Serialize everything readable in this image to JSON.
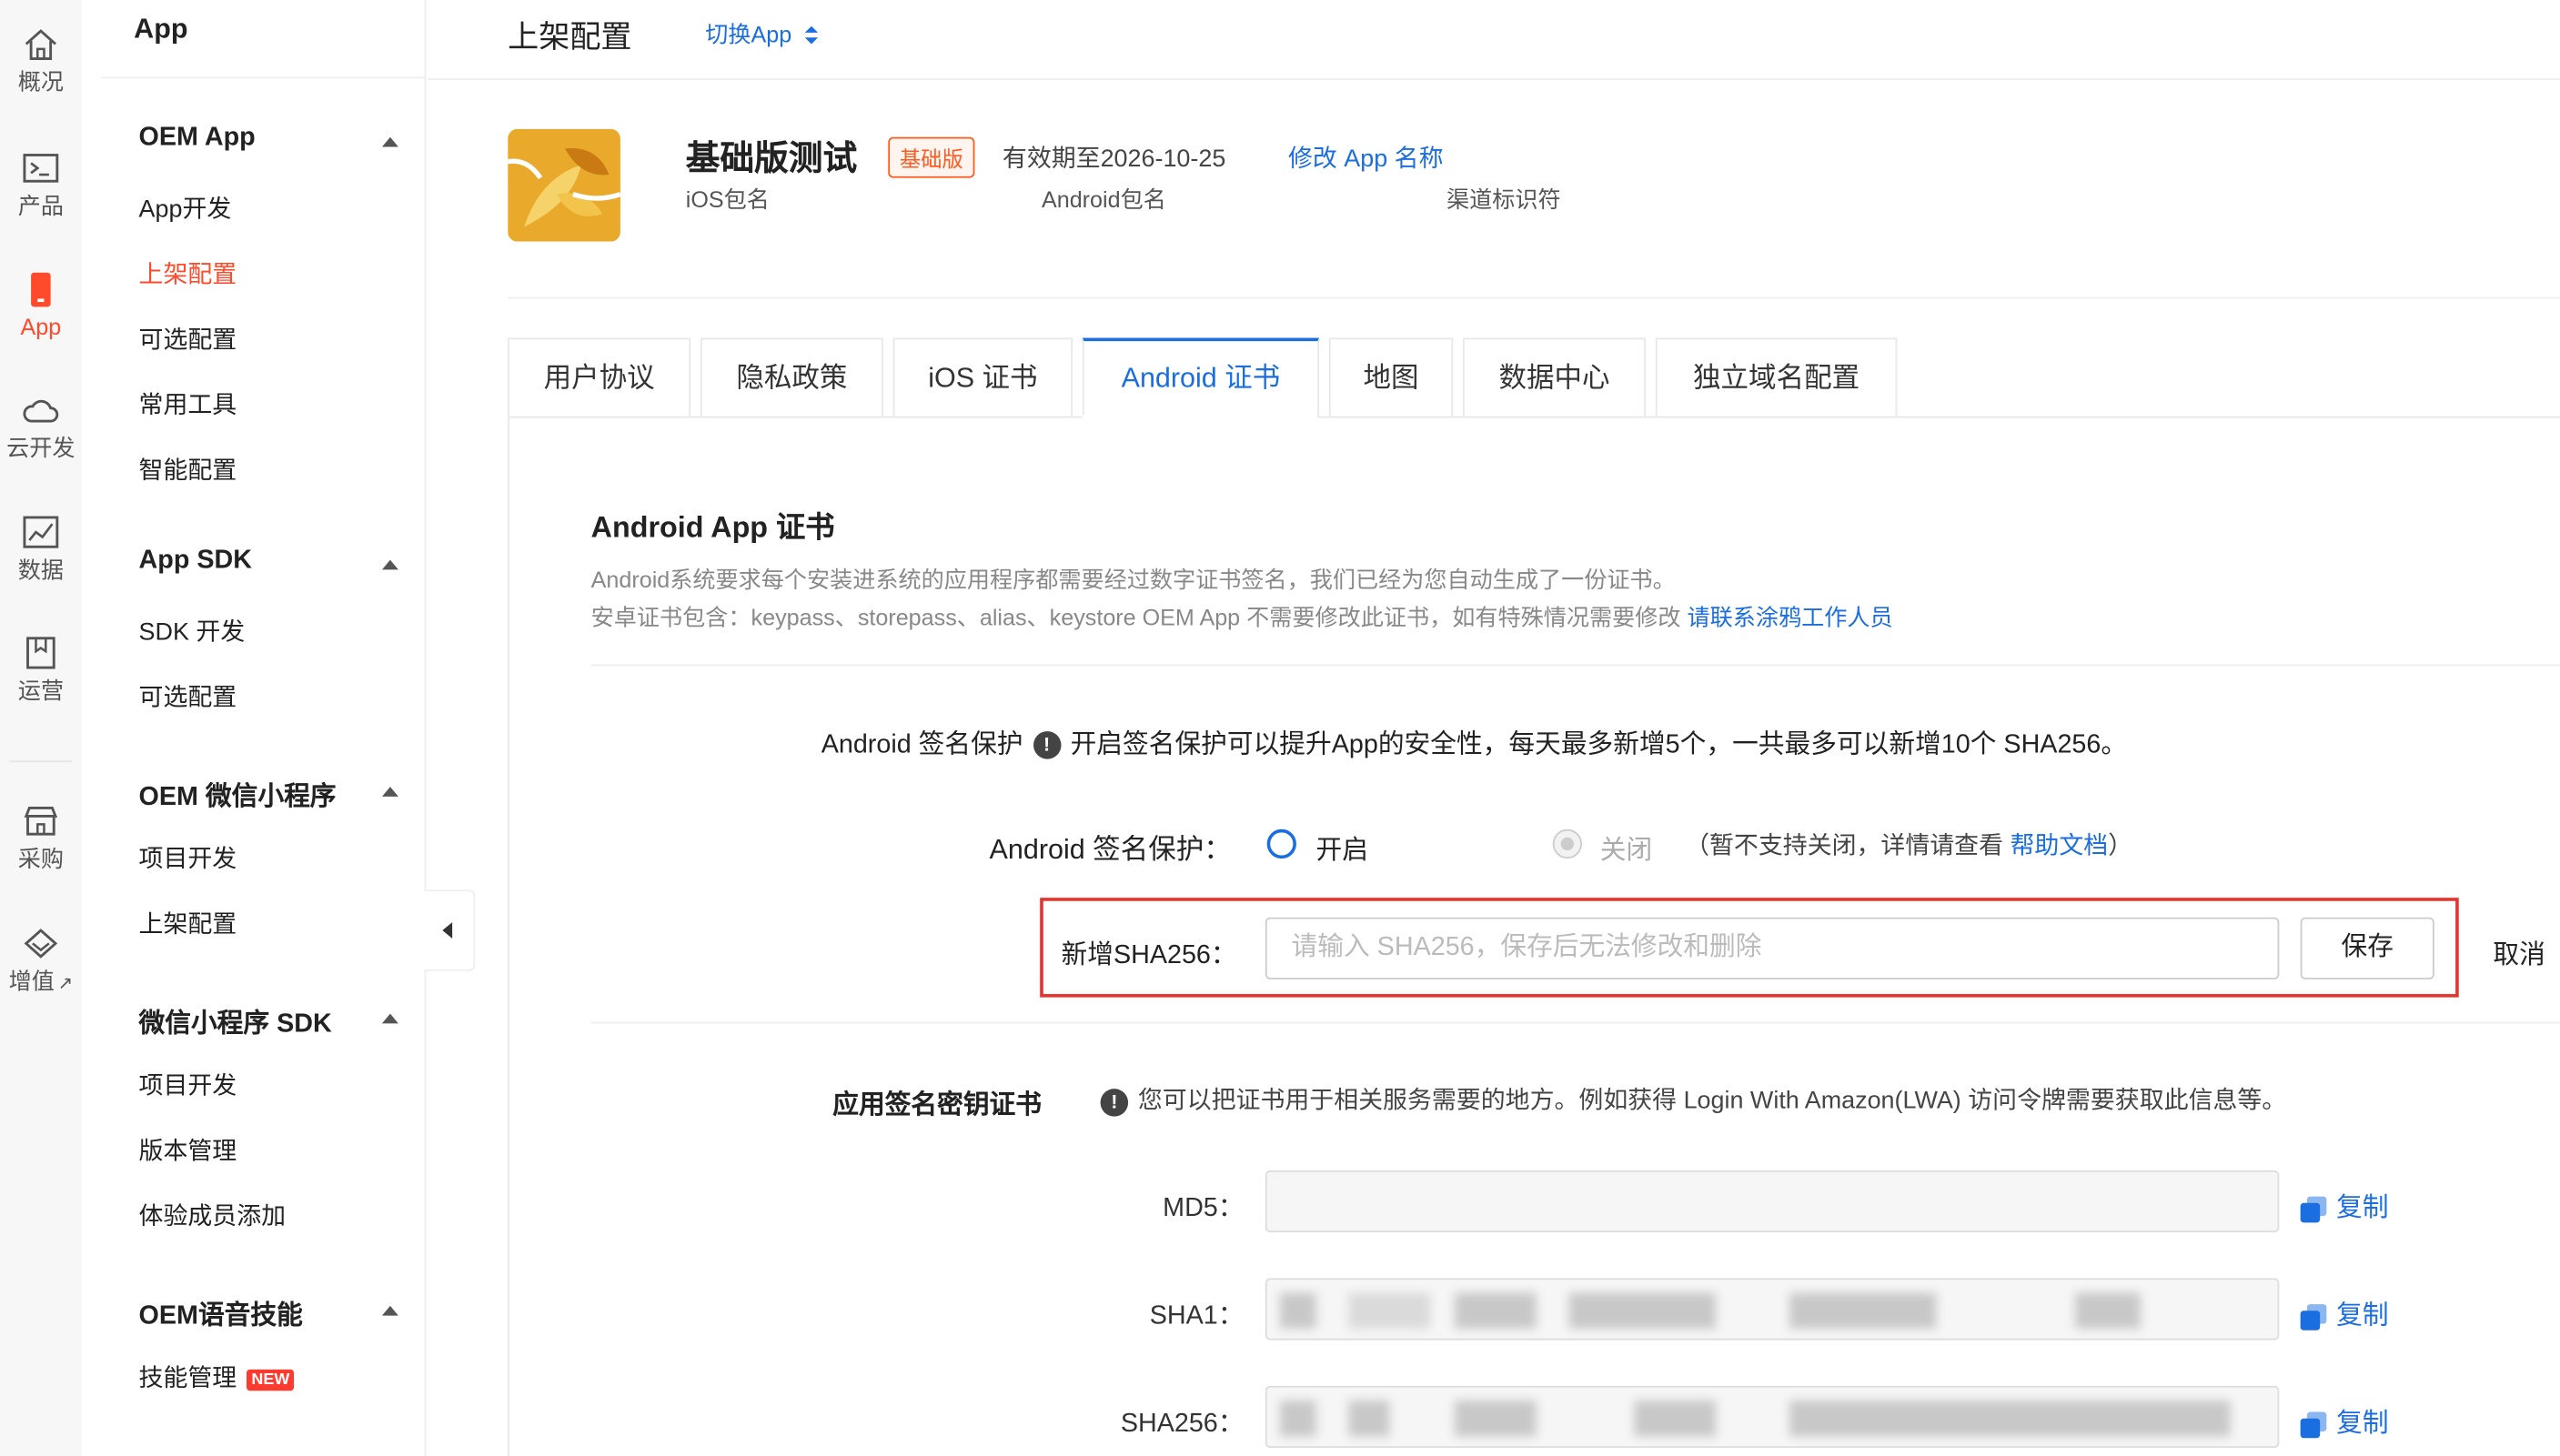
{
  "rail": {
    "items": [
      {
        "label": "概况",
        "icon": "home-icon"
      },
      {
        "label": "产品",
        "icon": "terminal-icon"
      },
      {
        "label": "App",
        "icon": "phone-icon"
      },
      {
        "label": "云开发",
        "icon": "cloud-icon"
      },
      {
        "label": "数据",
        "icon": "chart-icon"
      },
      {
        "label": "运营",
        "icon": "bookmark-icon"
      },
      {
        "label": "采购",
        "icon": "store-icon"
      },
      {
        "label": "增值",
        "icon": "diamond-icon"
      }
    ],
    "external_mark": "↗",
    "active_color": "#ff4a2b"
  },
  "menu": {
    "title": "App",
    "groups": [
      {
        "title": "OEM App",
        "items": [
          "App开发",
          "上架配置",
          "可选配置",
          "常用工具",
          "智能配置"
        ]
      },
      {
        "title": "App SDK",
        "items": [
          "SDK 开发",
          "可选配置"
        ]
      },
      {
        "title": "OEM 微信小程序",
        "items": [
          "项目开发",
          "上架配置"
        ]
      },
      {
        "title": "微信小程序 SDK",
        "items": [
          "项目开发",
          "版本管理",
          "体验成员添加"
        ]
      },
      {
        "title": "OEM语音技能",
        "items": [
          "技能管理"
        ]
      }
    ],
    "new_badge": "NEW"
  },
  "header": {
    "title": "上架配置",
    "switch_app": "切换App"
  },
  "app_info": {
    "name": "基础版测试",
    "edition": "基础版",
    "valid_until": "有效期至2026-10-25",
    "rename": "修改 App 名称",
    "ios_pkg_label": "iOS包名",
    "android_pkg_label": "Android包名",
    "channel_label": "渠道标识符"
  },
  "tabs": [
    "用户协议",
    "隐私政策",
    "iOS 证书",
    "Android 证书",
    "地图",
    "数据中心",
    "独立域名配置"
  ],
  "cert": {
    "title": "Android App 证书",
    "desc1": "Android系统要求每个安装进系统的应用程序都需要经过数字证书签名，我们已经为您自动生成了一份证书。",
    "desc2": "安卓证书包含：keypass、storepass、alias、keystore OEM App 不需要修改此证书，如有特殊情况需要修改",
    "desc2_link": "请联系涂鸦工作人员"
  },
  "protection": {
    "intro_label": "Android 签名保护",
    "intro_text": "开启签名保护可以提升App的安全性，每天最多新增5个，一共最多可以新增10个 SHA256。",
    "label": "Android 签名保护：",
    "on": "开启",
    "off": "关闭",
    "note_prefix": "（暂不支持关闭，详情请查看 ",
    "note_link": "帮助文档",
    "note_suffix": "）",
    "info_glyph": "!"
  },
  "sha_add": {
    "label": "新增SHA256：",
    "placeholder": "请输入 SHA256，保存后无法修改和删除",
    "save": "保存",
    "cancel": "取消"
  },
  "signing_keys": {
    "title": "应用签名密钥证书",
    "desc": "您可以把证书用于相关服务需要的地方。例如获得 Login With Amazon(LWA) 访问令牌需要获取此信息等。",
    "rows": [
      {
        "label": "MD5：",
        "copy": "复制"
      },
      {
        "label": "SHA1：",
        "copy": "复制"
      },
      {
        "label": "SHA256：",
        "copy": "复制"
      }
    ]
  },
  "colors": {
    "accent": "#1a6ee0",
    "brand": "#ff4a2b",
    "highlight_border": "#e8332c"
  }
}
